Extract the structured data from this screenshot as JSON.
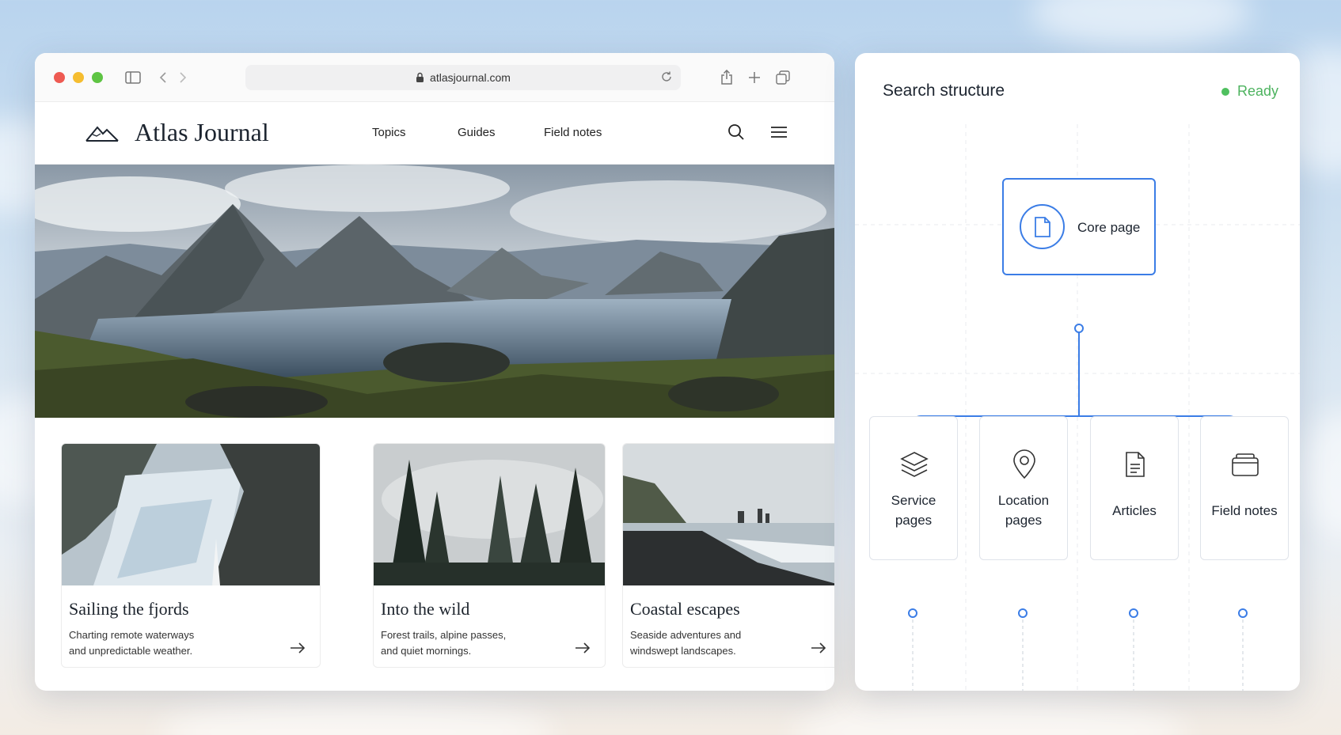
{
  "browser": {
    "url": "atlasjournal.com"
  },
  "site": {
    "brand": "Atlas Journal",
    "nav": [
      "Topics",
      "Guides",
      "Field notes"
    ]
  },
  "cards": [
    {
      "title": "Sailing the fjords",
      "desc_line1": "Charting remote waterways",
      "desc_line2": "and unpredictable weather."
    },
    {
      "title": "Into the wild",
      "desc_line1": "Forest trails, alpine passes,",
      "desc_line2": "and quiet mornings."
    },
    {
      "title": "Coastal escapes",
      "desc_line1": "Seaside adventures and",
      "desc_line2": "windswept landscapes."
    }
  ],
  "panel": {
    "title": "Search structure",
    "status": "Ready",
    "core": "Core page",
    "children": [
      {
        "line1": "Service",
        "line2": "pages",
        "icon": "layers-icon"
      },
      {
        "line1": "Location",
        "line2": "pages",
        "icon": "map-pin-icon"
      },
      {
        "line1": "Articles",
        "line2": "",
        "icon": "document-icon"
      },
      {
        "line1": "Field notes",
        "line2": "",
        "icon": "folder-icon"
      }
    ]
  },
  "colors": {
    "accent": "#3b7de6",
    "status": "#4fc05f"
  }
}
